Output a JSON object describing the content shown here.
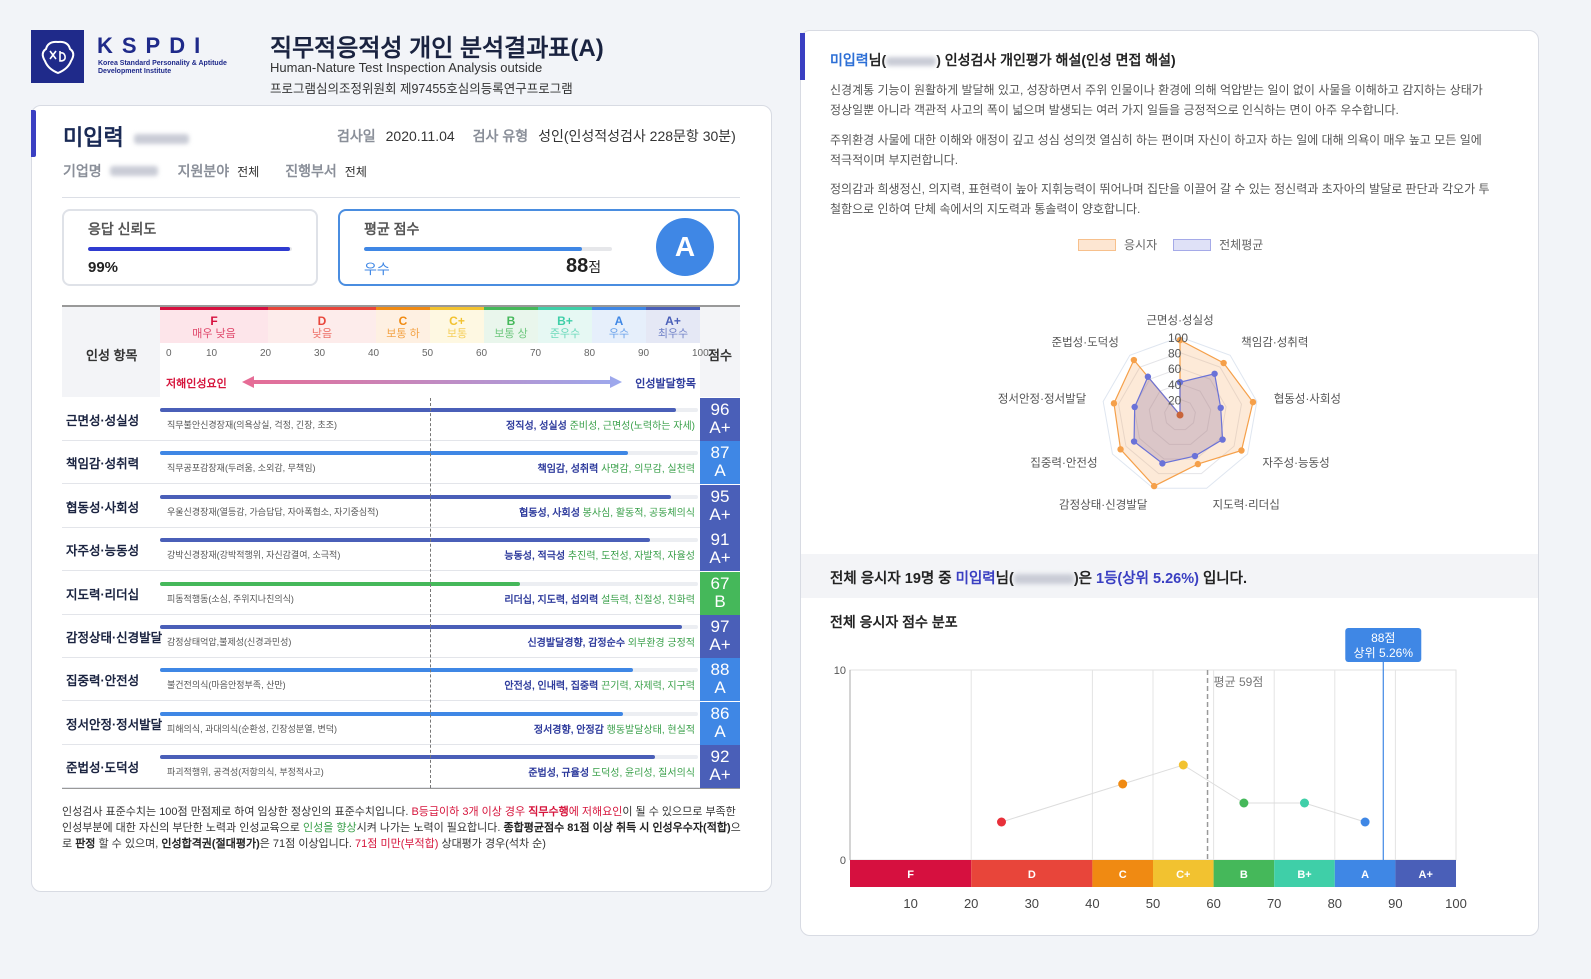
{
  "header": {
    "logo_text": "KSPDI",
    "logo_sub": "Korea Standard Personality & Aptitude Development Institute",
    "title": "직무적응적성 개인 분석결과표(A)",
    "subtitle_en": "Human-Nature Test Inspection Analysis outside",
    "registration": "프로그램심의조정위원회 제97455호심의등록연구프로그램"
  },
  "profile": {
    "name": "미입력",
    "test_date_label": "검사일",
    "test_date": "2020.11.04",
    "test_type_label": "검사 유형",
    "test_type": "성인(인성적성검사 228문항 30분)",
    "company_label": "기업명",
    "field_label": "지원분야",
    "field_value": "전체",
    "dept_label": "진행부서",
    "dept_value": "전체"
  },
  "summary": {
    "reliability_label": "응답 신뢰도",
    "reliability_value": "99%",
    "reliability_pct": 99,
    "reliability_color": "#2f3bd0",
    "avg_label": "평균 점수",
    "avg_grade_text": "우수",
    "avg_score": "88",
    "avg_unit": "점",
    "avg_pct": 88,
    "avg_color": "#3f87e5",
    "grade": "A"
  },
  "table": {
    "item_header": "인성 항목",
    "score_header": "점수",
    "neg_label": "저해인성요인",
    "pos_label": "인성발달항목",
    "grades": [
      {
        "grade": "F",
        "desc": "매우 낮음",
        "color": "#d6103f",
        "bg": "#fde5ea",
        "from": 0,
        "to": 20
      },
      {
        "grade": "D",
        "desc": "낮음",
        "color": "#e8453a",
        "bg": "#fdeceb",
        "from": 20,
        "to": 40
      },
      {
        "grade": "C",
        "desc": "보통 하",
        "color": "#f08a12",
        "bg": "#fef0e2",
        "from": 40,
        "to": 50
      },
      {
        "grade": "C+",
        "desc": "보통",
        "color": "#f2c230",
        "bg": "#fef8e2",
        "from": 50,
        "to": 60
      },
      {
        "grade": "B",
        "desc": "보통 상",
        "color": "#45b85a",
        "bg": "#e9f6ec",
        "from": 60,
        "to": 70
      },
      {
        "grade": "B+",
        "desc": "준우수",
        "color": "#3fcfa8",
        "bg": "#e6f8f3",
        "from": 70,
        "to": 80
      },
      {
        "grade": "A",
        "desc": "우수",
        "color": "#3f87e5",
        "bg": "#e6effb",
        "from": 80,
        "to": 90
      },
      {
        "grade": "A+",
        "desc": "최우수",
        "color": "#4a5fb8",
        "bg": "#e5e8f5",
        "from": 90,
        "to": 100
      }
    ],
    "ticks": [
      "0",
      "10",
      "20",
      "30",
      "40",
      "50",
      "60",
      "70",
      "80",
      "90",
      "100"
    ],
    "rows": [
      {
        "label": "근면성·성실성",
        "score": 96,
        "grade": "A+",
        "neg": "직무불안신경장재(의욕상실, 걱정, 긴장, 초조)",
        "pos_key": "정직성, 성실성",
        "pos_rest": " 준비성, 근면성(노력하는 자세)"
      },
      {
        "label": "책임감·성취력",
        "score": 87,
        "grade": "A",
        "neg": "직무공포감장재(두려움, 소외감, 무책임)",
        "pos_key": "책임감, 성취력",
        "pos_rest": " 사명감, 의무감, 실천력"
      },
      {
        "label": "협동성·사회성",
        "score": 95,
        "grade": "A+",
        "neg": "우울신경장재(열등감, 가슴답답, 자아폭협소, 자기중심적)",
        "pos_key": "협동성, 사회성",
        "pos_rest": " 봉사심, 활동적, 공동체의식"
      },
      {
        "label": "자주성·능동성",
        "score": 91,
        "grade": "A+",
        "neg": "강박신경장재(강박적행위, 자신감결여, 소극적)",
        "pos_key": "능동성, 적극성",
        "pos_rest": " 추진력, 도전성, 자발적, 자율성"
      },
      {
        "label": "지도력·리더십",
        "score": 67,
        "grade": "B",
        "neg": "피동적행동(소심, 주위지나친의식)",
        "pos_key": "리더십, 지도력, 섭외력",
        "pos_rest": " 설득력, 친절성, 친화력"
      },
      {
        "label": "감정상태·신경발달",
        "score": 97,
        "grade": "A+",
        "neg": "감정상태억압,불제성(신경과민성)",
        "pos_key": "신경발달경향, 감정순수",
        "pos_rest": " 외부환경 긍정적"
      },
      {
        "label": "집중력·안전성",
        "score": 88,
        "grade": "A",
        "neg": "불건전의식(마음안정부족, 산만)",
        "pos_key": "안전성, 인내력, 집중력",
        "pos_rest": " 끈기력, 자제력, 지구력"
      },
      {
        "label": "정서안정·정서발달",
        "score": 86,
        "grade": "A",
        "neg": "피해의식, 과대의식(순환성, 긴장성분열, 변덕)",
        "pos_key": "정서경향, 안정감",
        "pos_rest": " 행동발달상태, 현실적"
      },
      {
        "label": "준법성·도덕성",
        "score": 92,
        "grade": "A+",
        "neg": "파괴적행위, 공격성(저항의식, 부정적사고)",
        "pos_key": "준법성, 규율성",
        "pos_rest": " 도덕성, 윤리성, 질서의식"
      }
    ]
  },
  "note": {
    "p1": "인성검사 표준수치는 100점 만점제로 하여 임상한 정상인의 표준수치입니다. ",
    "p2": "B등급이하 3개 이상 경우 ",
    "p3": "직무수행",
    "p4": "에 저해요인",
    "p5": "이 될 수 있으므로 부족한 인성부분에 대한 자신의 부단한 노력과 인성교육으로 ",
    "p6": "인성을 향상",
    "p7": "시켜 나가는 노력이 필요합니다. ",
    "p8": "종합평균점수 81점 이상 취득 시 인성우수자(적합)",
    "p9": "으로 ",
    "p10": "판정",
    "p11": " 할 수 있으며, ",
    "p12": "인성합격권(절대평가)",
    "p13": "은 71점 이상입니다. ",
    "p14": "71점 미만(부적합)",
    "p15": " 상대평가 경우(석차 순)"
  },
  "interpretation": {
    "title_name": "미입력",
    "title_rest": "님(",
    "title_tail": ") 인성검사 개인평가 해설(인성 면접 해설)",
    "paragraphs": [
      "신경계통 기능이 원활하게 발달해 있고, 성장하면서 주위 인물이나 환경에 의해 억압받는 일이 없이 사물을 이해하고 감지하는 상태가 정상일뿐 아니라 객관적 사고의 폭이 넓으며 발생되는 여러 가지 일들을 긍정적으로 인식하는 면이 아주 우수합니다.",
      "주위환경 사물에 대한 이해와 애정이 깊고 성심 성의껏 열심히 하는 편이며 자신이 하고자 하는 일에 대해 의욕이 매우 높고 모든 일에 적극적이며 부지런합니다.",
      "정의감과 희생정신, 의지력, 표현력이 높아 지휘능력이 뛰어나며 집단을 이끌어 갈 수 있는 정신력과 초자아의 발달로 판단과 각오가 투철함으로 인하여 단체 속에서의 지도력과 통솔력이 양호합니다."
    ]
  },
  "rank": {
    "pre": "전체 응시자 19명 중 ",
    "name": "미입력",
    "mid": "님(",
    "post": ")은 ",
    "rank": "1등(상위 5.26%)",
    "end": " 입니다."
  },
  "chart_data": [
    {
      "type": "radar",
      "title": "",
      "legend": [
        "응시자",
        "전체평균"
      ],
      "legend_placement": "top",
      "axes": [
        "근면성·성실성",
        "책임감·성취력",
        "협동성·사회성",
        "자주성·능동성",
        "지도력·리더십",
        "감정상태·신경발달",
        "집중력·안전성",
        "정서안정·정서발달",
        "준법성·도덕성"
      ],
      "ticks": [
        "20",
        "40",
        "60",
        "80",
        "100"
      ],
      "range": [
        0,
        100
      ],
      "series": [
        {
          "name": "응시자",
          "values": [
            96,
            87,
            95,
            91,
            67,
            97,
            88,
            86,
            92
          ],
          "color": "#f5a04a"
        },
        {
          "name": "전체평균",
          "values": [
            42,
            69,
            53,
            63,
            56,
            66,
            68,
            59,
            64
          ],
          "color": "#6a72d8"
        }
      ]
    },
    {
      "type": "line",
      "title": "전체 응시자 점수 분포",
      "xlabel": "",
      "ylabel": "",
      "x": [
        25,
        45,
        55,
        65,
        75,
        85
      ],
      "values": [
        2,
        4,
        5,
        3,
        3,
        2
      ],
      "point_colors": [
        "#e8303a",
        "#f08a12",
        "#f2c230",
        "#45b85a",
        "#3fcfa8",
        "#3f87e5"
      ],
      "ylim": [
        0,
        10
      ],
      "y_ticks": [
        "0",
        "10"
      ],
      "xlim": [
        0,
        100
      ],
      "x_ticks": [
        "10",
        "20",
        "30",
        "40",
        "50",
        "60",
        "70",
        "80",
        "90",
        "100"
      ],
      "grade_bands": [
        {
          "label": "F",
          "from": 0,
          "to": 20,
          "color": "#d6103f"
        },
        {
          "label": "D",
          "from": 20,
          "to": 40,
          "color": "#e8453a"
        },
        {
          "label": "C",
          "from": 40,
          "to": 50,
          "color": "#f08a12"
        },
        {
          "label": "C+",
          "from": 50,
          "to": 60,
          "color": "#f2c230"
        },
        {
          "label": "B",
          "from": 60,
          "to": 70,
          "color": "#45b85a"
        },
        {
          "label": "B+",
          "from": 70,
          "to": 80,
          "color": "#3fcfa8"
        },
        {
          "label": "A",
          "from": 80,
          "to": 90,
          "color": "#3f87e5"
        },
        {
          "label": "A+",
          "from": 90,
          "to": 100,
          "color": "#4a5fb8"
        }
      ],
      "avg_line": {
        "value": 59,
        "label": "평균 59점"
      },
      "marker": {
        "value": 88,
        "label1": "88점",
        "label2": "상위 5.26%"
      }
    }
  ]
}
